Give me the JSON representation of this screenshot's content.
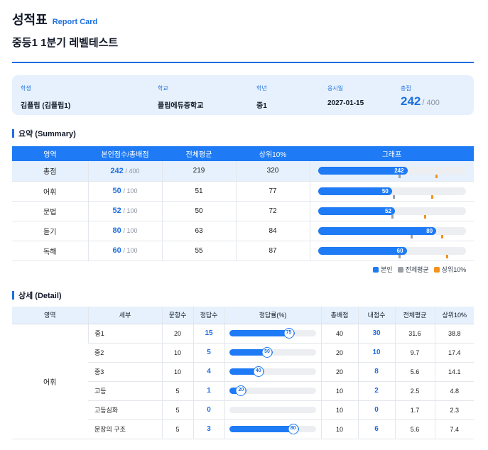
{
  "header": {
    "title": "성적표",
    "title_en": "Report Card",
    "subtitle": "중등1 1분기 레벨테스트"
  },
  "info": {
    "student_label": "학생",
    "student_value": "김플립 (김플립1)",
    "school_label": "학교",
    "school_value": "플립에듀중학교",
    "grade_label": "학년",
    "grade_value": "중1",
    "date_label": "응시일",
    "date_value": "2027-01-15",
    "total_label": "총점",
    "total_score": "242",
    "total_max": "/ 400"
  },
  "summary": {
    "title": "요약 (Summary)",
    "headers": [
      "영역",
      "본인점수/총배점",
      "전체평균",
      "상위10%",
      "그래프"
    ],
    "rows": [
      {
        "area": "총점",
        "score": 242,
        "max": "/ 400",
        "avg": "219",
        "top10": "320",
        "total_row": true
      },
      {
        "area": "어휘",
        "score": 50,
        "max": "/ 100",
        "avg": "51",
        "top10": "77"
      },
      {
        "area": "문법",
        "score": 52,
        "max": "/ 100",
        "avg": "50",
        "top10": "72"
      },
      {
        "area": "듣기",
        "score": 80,
        "max": "/ 100",
        "avg": "63",
        "top10": "84"
      },
      {
        "area": "독해",
        "score": 60,
        "max": "/ 100",
        "avg": "55",
        "top10": "87"
      }
    ],
    "legend": [
      {
        "label": "본인",
        "color": "#1e7bf5"
      },
      {
        "label": "전체평균",
        "color": "#9aa0a6"
      },
      {
        "label": "상위10%",
        "color": "#f5921e"
      }
    ]
  },
  "detail": {
    "title": "상세 (Detail)",
    "headers": [
      "영역",
      "세부",
      "문항수",
      "정답수",
      "정답률(%)",
      "총배점",
      "내점수",
      "전체평균",
      "상위10%"
    ],
    "area": "어휘",
    "rows": [
      {
        "sub": "중1",
        "items": "20",
        "correct": "15",
        "rate": 75,
        "max": "40",
        "score": "30",
        "avg": "31.6",
        "top10": "38.8"
      },
      {
        "sub": "중2",
        "items": "10",
        "correct": "5",
        "rate": 50,
        "max": "20",
        "score": "10",
        "avg": "9.7",
        "top10": "17.4"
      },
      {
        "sub": "중3",
        "items": "10",
        "correct": "4",
        "rate": 40,
        "max": "20",
        "score": "8",
        "avg": "5.6",
        "top10": "14.1"
      },
      {
        "sub": "고등",
        "items": "5",
        "correct": "1",
        "rate": 20,
        "max": "10",
        "score": "2",
        "avg": "2.5",
        "top10": "4.8"
      },
      {
        "sub": "고등심화",
        "items": "5",
        "correct": "0",
        "rate": 0,
        "max": "10",
        "score": "0",
        "avg": "1.7",
        "top10": "2.3"
      },
      {
        "sub": "문장의 구조",
        "items": "5",
        "correct": "3",
        "rate": 80,
        "max": "10",
        "score": "6",
        "avg": "5.6",
        "top10": "7.4"
      }
    ]
  }
}
